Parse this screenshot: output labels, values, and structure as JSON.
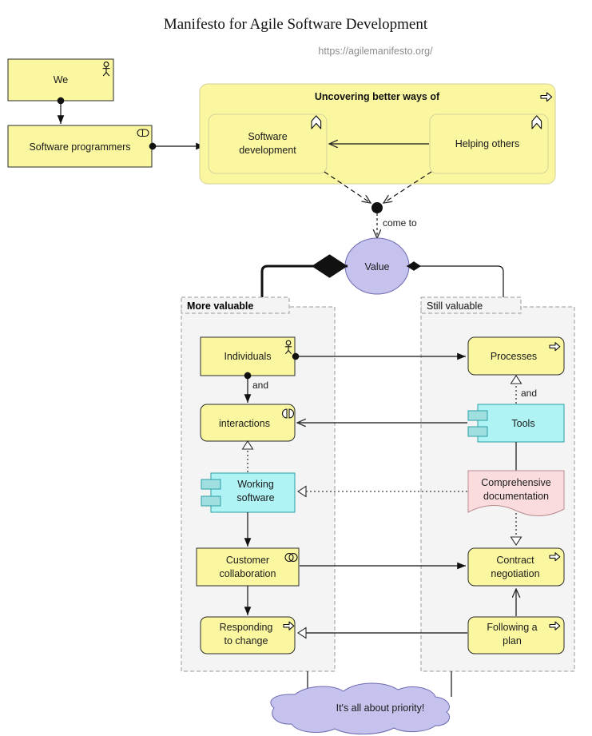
{
  "header": {
    "title": "Manifesto for Agile Software Development",
    "subtitle": "https://agilemanifesto.org/"
  },
  "nodes": {
    "we": {
      "label": "We",
      "icon": "actor-icon",
      "fill": "#FAF7A0"
    },
    "software_programmers": {
      "label": "Software programmers",
      "icon": "role-icon",
      "fill": "#FAF7A0"
    },
    "uncovering": {
      "label": "Uncovering better ways of",
      "icon": "process-arrow-icon",
      "fill": "#FAF7A0"
    },
    "software_development": {
      "label_line1": "Software",
      "label_line2": "development",
      "icon": "function-chevron-icon",
      "fill": "#FAF7A0"
    },
    "helping_others": {
      "label": "Helping others",
      "icon": "function-chevron-icon",
      "fill": "#FAF7A0"
    },
    "value": {
      "label": "Value",
      "fill": "#C5C3EE"
    },
    "individuals": {
      "label": "Individuals",
      "icon": "actor-icon",
      "fill": "#FAF7A0"
    },
    "interactions": {
      "label": "interactions",
      "icon": "interaction-icon",
      "fill": "#FAF7A0"
    },
    "working_software": {
      "label_line1": "Working",
      "label_line2": "software",
      "icon": "component-icon",
      "fill": "#AFF3F5"
    },
    "customer_collaboration": {
      "label_line1": "Customer",
      "label_line2": "collaboration",
      "icon": "collaboration-icon",
      "fill": "#FAF7A0"
    },
    "responding_to_change": {
      "label_line1": "Responding",
      "label_line2": "to change",
      "icon": "process-arrow-icon",
      "fill": "#FAF7A0"
    },
    "processes": {
      "label": "Processes",
      "icon": "process-arrow-icon",
      "fill": "#FAF7A0"
    },
    "tools": {
      "label": "Tools",
      "icon": "component-icon",
      "fill": "#AFF3F5"
    },
    "comprehensive_documentation": {
      "label_line1": "Comprehensive",
      "label_line2": "documentation",
      "icon": "note-icon",
      "fill": "#FADCDE"
    },
    "contract_negotiation": {
      "label_line1": "Contract",
      "label_line2": "negotiation",
      "icon": "process-arrow-icon",
      "fill": "#FAF7A0"
    },
    "following_a_plan": {
      "label_line1": "Following a",
      "label_line2": "plan",
      "icon": "process-arrow-icon",
      "fill": "#FAF7A0"
    },
    "priority_cloud": {
      "label": "It's all about priority!",
      "fill": "#C5C3EE"
    }
  },
  "groups": {
    "more_valuable": {
      "label": "More valuable",
      "fill": "#F4F4F4"
    },
    "still_valuable": {
      "label": "Still valuable",
      "fill": "#F4F4F4"
    }
  },
  "edge_labels": {
    "come_to": "come to",
    "and_left": "and",
    "and_right": "and"
  },
  "colors": {
    "yellow": "#FAF7A0",
    "cyan": "#AFF3F5",
    "pink": "#FADCDE",
    "lavender": "#C5C3EE",
    "group_grey": "#F4F4F4",
    "stroke": "#2b2b2b",
    "subtitle_grey": "#8d8d8d"
  }
}
